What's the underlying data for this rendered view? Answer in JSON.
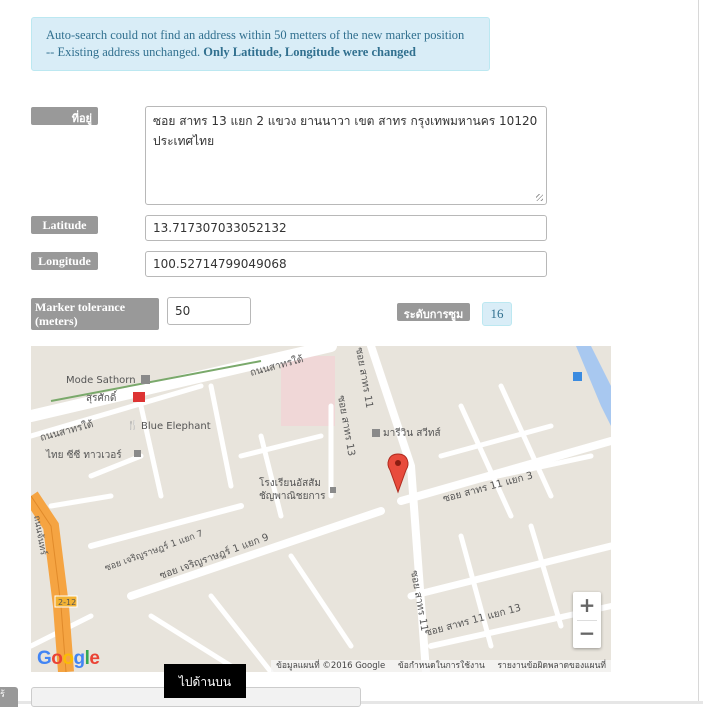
{
  "alert": {
    "line1": "Auto-search could not find an address within 50 metters of the new marker position",
    "line2_plain": "-- Existing address unchanged.",
    "line2_bold": "Only Latitude, Longitude were changed"
  },
  "form": {
    "address_label": "ที่อยู่",
    "address_line1": "ซอย สาทร 13 แยก 2 แขวง ยานนาวา เขต สาทร กรุงเทพมหานคร 10120",
    "address_line2": "ประเทศไทย",
    "latitude_label": "Latitude",
    "latitude_value": "13.717307033052132",
    "longitude_label": "Longitude",
    "longitude_value": "100.52714799049068",
    "tolerance_label": "Marker tolerance (meters)",
    "tolerance_value": "50",
    "zoom_label": "ระดับการซูม",
    "zoom_value": "16"
  },
  "map": {
    "labels": {
      "mode_sathorn": "Mode Sathorn",
      "surasak": "สุรศักดิ์",
      "blue_elephant": "Blue Elephant",
      "thai_cc_tower": "ไทย ซีซี ทาวเวอร์",
      "road_top_left": "ถนนสาทรใต้",
      "road_left": "ถนนสาทรใต้",
      "road_top_right": "ถนนสาทรใต้",
      "soi13_vertical": "ซอย สาทร 13",
      "soi11_vertical": "ซอย สาทร 11",
      "maruay": "มารีวิน สวีทส์",
      "school_line1": "โรงเรียนอัสสัม",
      "school_line2": "ชัญพาณิชยการ",
      "soi11_3": "ซอย สาทร 11 แยก 3",
      "charoen_7": "ซอย เจริญราษฎร์ 1 แยก 7",
      "charoen_9": "ซอย เจริญราษฎร์ 1 แยก 9",
      "soi11_13": "ซอย สาทร 11 แยก 13",
      "soi11_bottom": "ซอย สาทร 11",
      "road_212": "2-12",
      "road_left_edge": "ถนนจันทร์"
    },
    "zoom_in": "+",
    "zoom_out": "−",
    "google": [
      "G",
      "o",
      "o",
      "g",
      "l",
      "e"
    ],
    "google_colors": [
      "#4285F4",
      "#EA4335",
      "#FBBC05",
      "#4285F4",
      "#34A853",
      "#EA4335"
    ],
    "attribution": "ข้อมูลแผนที่ ©2016 Google",
    "terms": "ข้อกำหนดในการใช้งาน",
    "report": "รายงานข้อผิดพลาดของแผนที่"
  },
  "go_to_top": "ไปด้านบน",
  "left_stub": "ร้"
}
